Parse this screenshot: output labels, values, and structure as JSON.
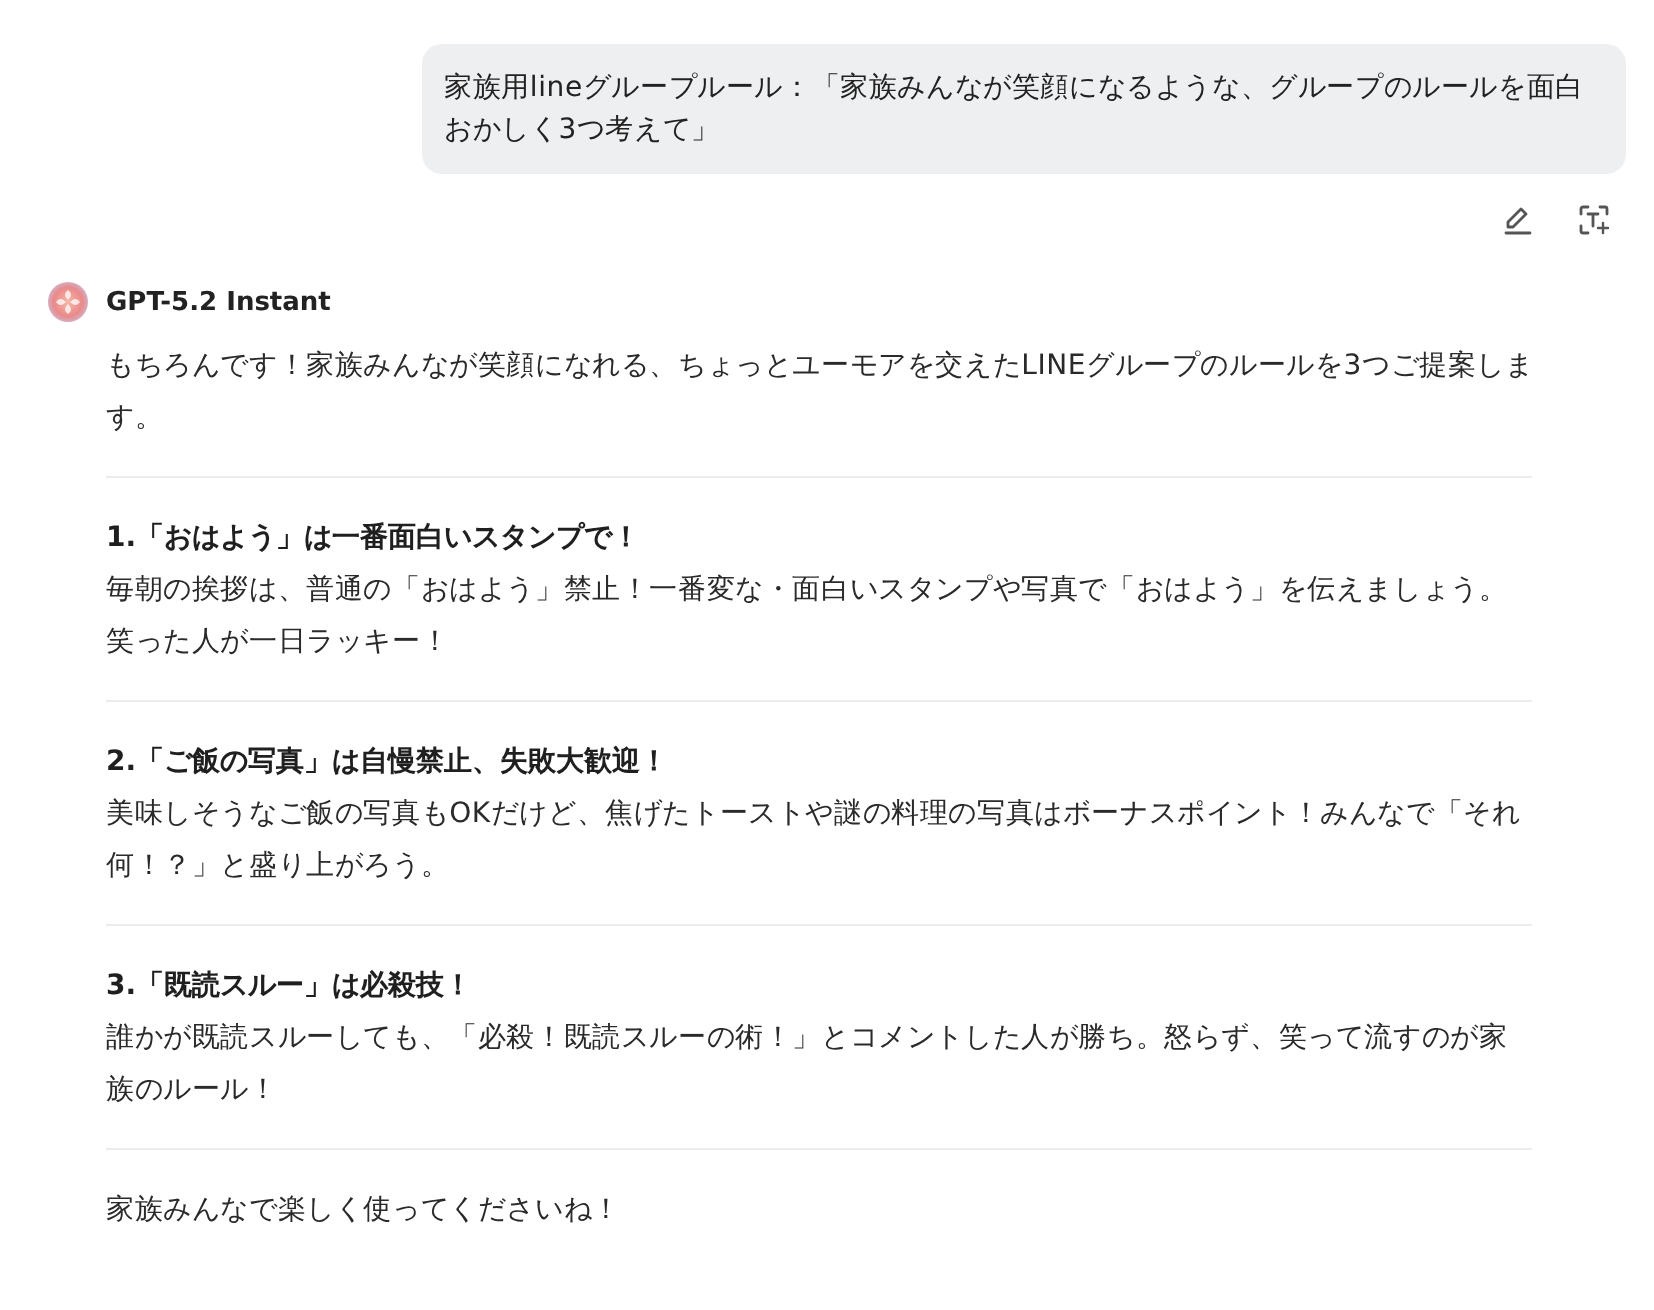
{
  "user_message": {
    "text": "家族用lineグループルール：「家族みんなが笑顔になるような、グループのルールを面白おかしく3つ考えて」",
    "actions": [
      {
        "kind": "edit"
      },
      {
        "kind": "text_scan"
      }
    ]
  },
  "assistant_message": {
    "model_name": "GPT-5.2 Instant",
    "intro": "もちろんです！家族みんなが笑顔になれる、ちょっとユーモアを交えたLINEグループのルールを3つご提案します。",
    "rules": [
      {
        "heading": "1.「おはよう」は一番面白いスタンプで！",
        "body": "毎朝の挨拶は、普通の「おはよう」禁止！一番変な・面白いスタンプや写真で「おはよう」を伝えましょう。笑った人が一日ラッキー！"
      },
      {
        "heading": "2.「ご飯の写真」は自慢禁止、失敗大歓迎！",
        "body": "美味しそうなご飯の写真もOKだけど、焦げたトーストや謎の料理の写真はボーナスポイント！みんなで「それ何！？」と盛り上がろう。"
      },
      {
        "heading": "3.「既読スルー」は必殺技！",
        "body": "誰かが既読スルーしても、「必殺！既読スルーの術！」とコメントした人が勝ち。怒らず、笑って流すのが家族のルール！"
      }
    ],
    "closing": "家族みんなで楽しく使ってくださいね！"
  }
}
